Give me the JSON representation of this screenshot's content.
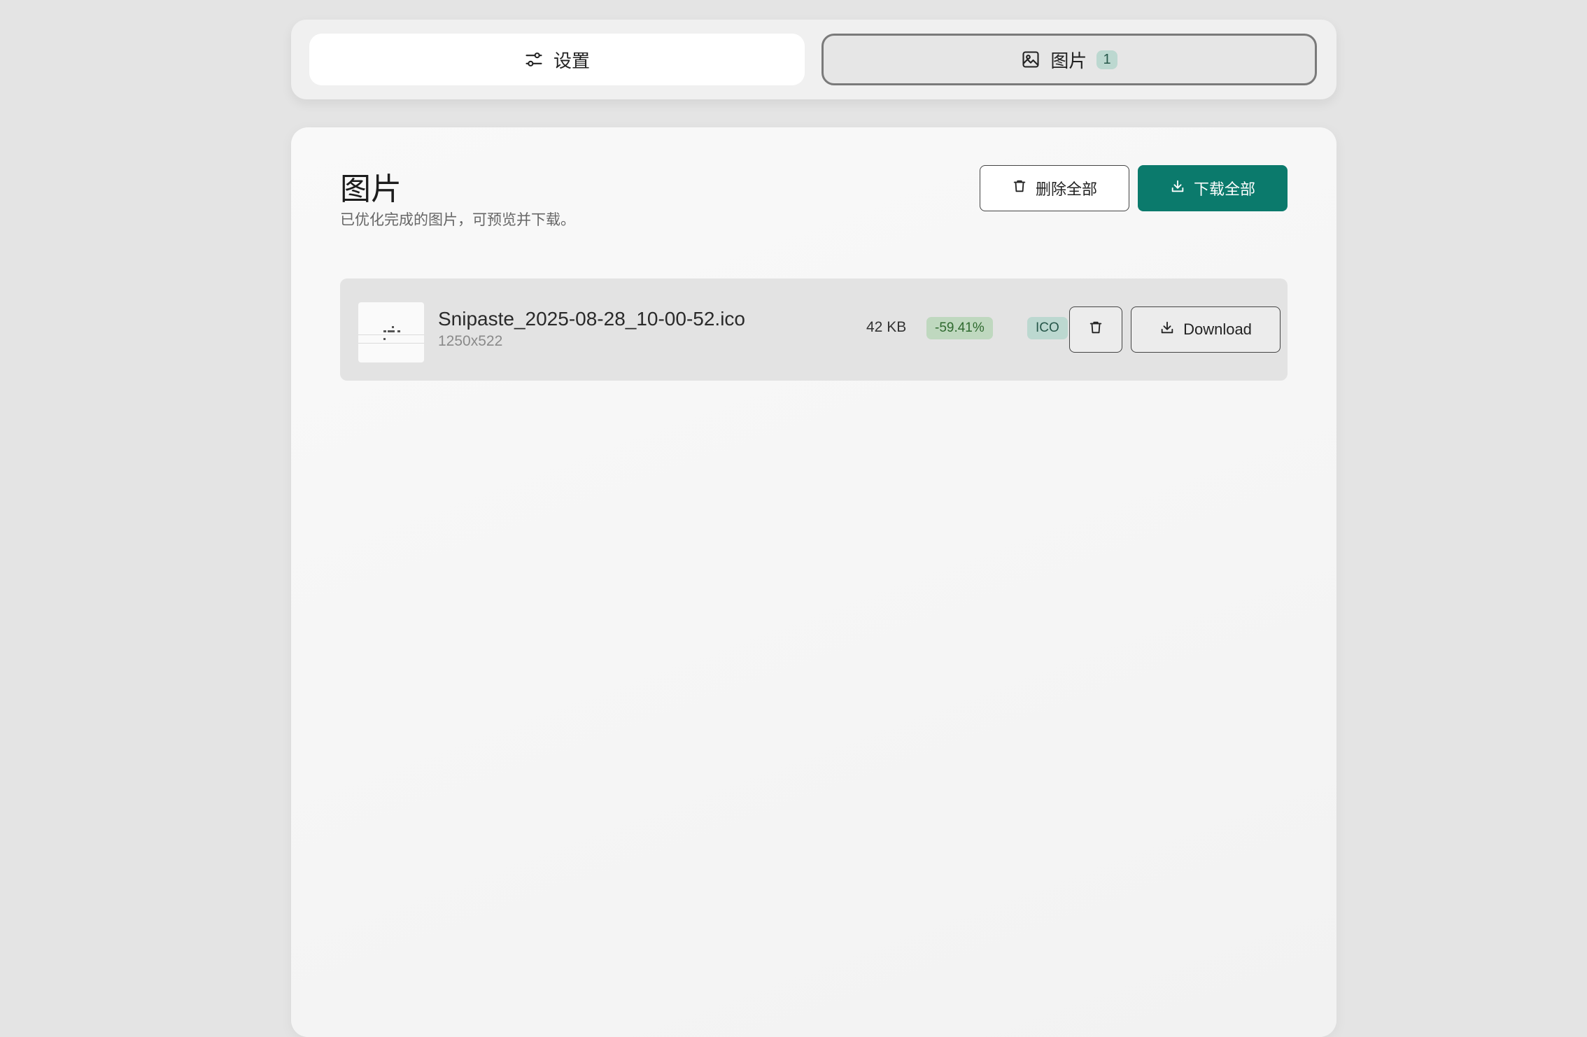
{
  "tabs": {
    "settings_label": "设置",
    "images_label": "图片",
    "images_count": "1"
  },
  "panel": {
    "title": "图片",
    "subtitle": "已优化完成的图片，可预览并下载。",
    "delete_all_label": "删除全部",
    "download_all_label": "下载全部"
  },
  "files": [
    {
      "name": "Snipaste_2025-08-28_10-00-52.ico",
      "dimensions": "1250x522",
      "size": "42 KB",
      "savings": "-59.41%",
      "format": "ICO",
      "download_label": "Download"
    }
  ],
  "colors": {
    "accent": "#0b7a6c",
    "savings_badge_bg": "#bfd8bf",
    "format_badge_bg": "#bcd8d0"
  },
  "icons": {
    "settings_tab": "sliders-icon",
    "images_tab": "image-icon",
    "delete": "trash-icon",
    "download": "download-icon"
  }
}
